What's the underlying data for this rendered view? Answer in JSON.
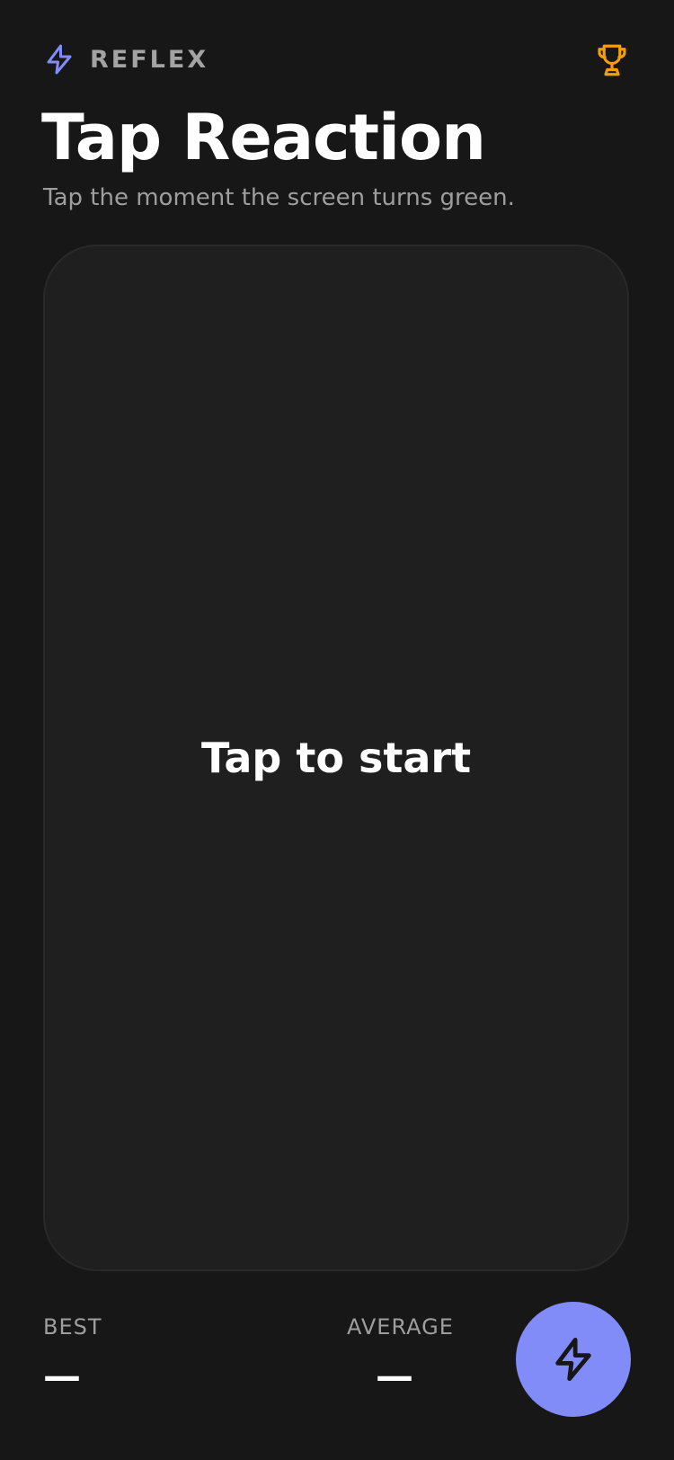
{
  "header": {
    "brand_icon": "bolt-icon",
    "brand_name": "REFLEX",
    "trophy_icon": "trophy-icon",
    "title": "Tap Reaction",
    "subtitle": "Tap the moment the screen turns green."
  },
  "game": {
    "prompt": "Tap to start"
  },
  "stats": {
    "best_label": "BEST",
    "best_value": "—",
    "average_label": "AVERAGE",
    "average_value": "—"
  },
  "fab": {
    "icon": "bolt-icon"
  },
  "colors": {
    "background": "#171717",
    "card": "#1f1f1f",
    "accent": "#818cf8",
    "trophy": "#f59e0b",
    "muted_text": "#9e9e9e"
  }
}
